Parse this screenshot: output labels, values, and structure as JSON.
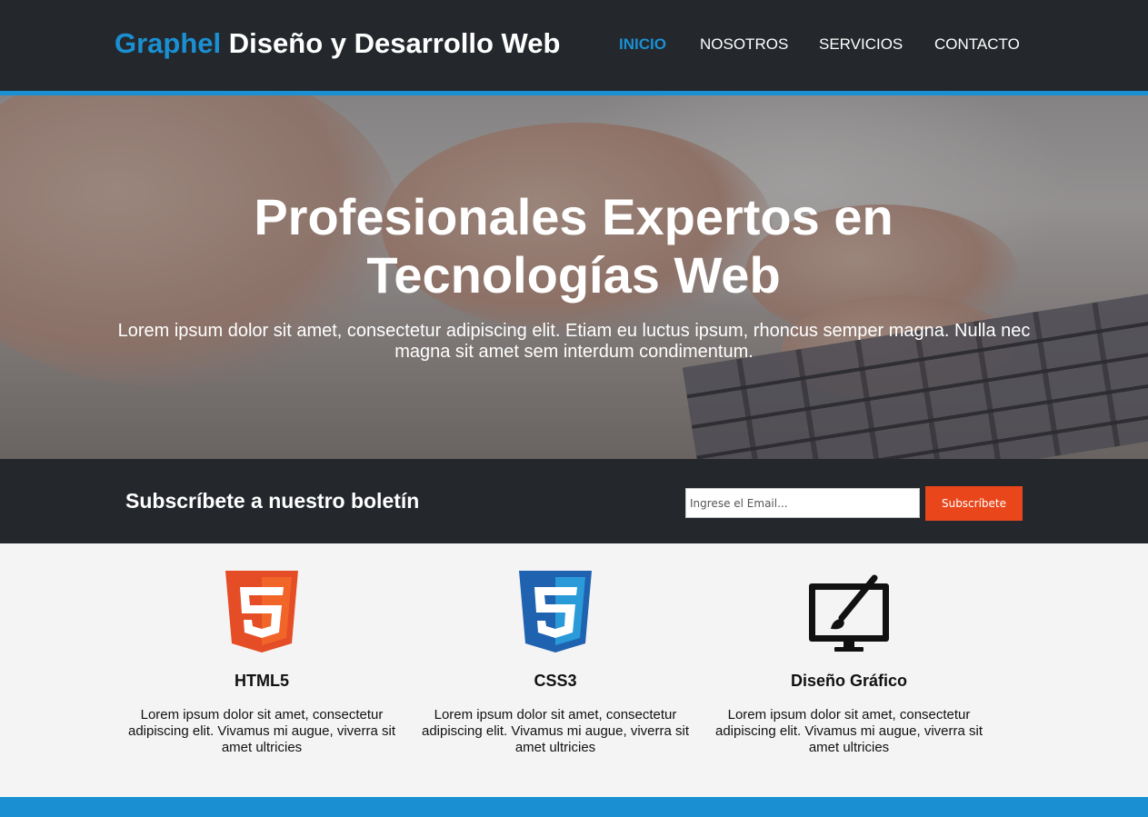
{
  "header": {
    "brand": "Graphel",
    "tagline": "Diseño y Desarrollo Web",
    "nav": [
      {
        "label": "INICIO",
        "active": true
      },
      {
        "label": "NOSOTROS",
        "active": false
      },
      {
        "label": "SERVICIOS",
        "active": false
      },
      {
        "label": "CONTACTO",
        "active": false
      }
    ]
  },
  "hero": {
    "title": "Profesionales Expertos en Tecnologías Web",
    "text": "Lorem ipsum dolor sit amet, consectetur adipiscing elit. Etiam eu luctus ipsum, rhoncus semper magna. Nulla nec magna sit amet sem interdum condimentum."
  },
  "newsletter": {
    "title": "Subscríbete a nuestro boletín",
    "placeholder": "Ingrese el Email...",
    "button": "Subscríbete"
  },
  "features": [
    {
      "icon": "html5-icon",
      "title": "HTML5",
      "text": "Lorem ipsum dolor sit amet, consectetur adipiscing elit. Vivamus mi augue, viverra sit amet ultricies"
    },
    {
      "icon": "css3-icon",
      "title": "CSS3",
      "text": "Lorem ipsum dolor sit amet, consectetur adipiscing elit. Vivamus mi augue, viverra sit amet ultricies"
    },
    {
      "icon": "graphic-design-monitor-icon",
      "title": "Diseño Gráfico",
      "text": "Lorem ipsum dolor sit amet, consectetur adipiscing elit. Vivamus mi augue, viverra sit amet ultricies"
    }
  ],
  "colors": {
    "accent": "#1a90d3",
    "dark": "#24282d",
    "button": "#e9471b",
    "html5": "#e44d26",
    "css3": "#1f62b0"
  }
}
